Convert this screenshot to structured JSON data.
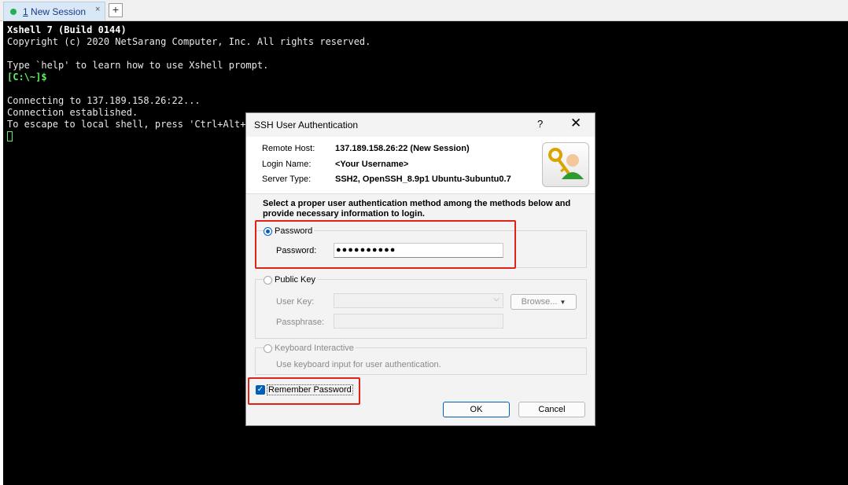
{
  "tabs": {
    "active_num": "1",
    "active_label": "New Session",
    "close": "×",
    "new_tab": "+"
  },
  "terminal": {
    "lines": [
      "Xshell 7 (Build 0144)",
      "Copyright (c) 2020 NetSarang Computer, Inc. All rights reserved.",
      "Type `help' to learn how to use Xshell prompt.",
      "[C:\\~]$",
      "Connecting to 137.189.158.26:22...",
      "Connection established.",
      "To escape to local shell, press 'Ctrl+Alt+]"
    ]
  },
  "dialog": {
    "title": "SSH User Authentication",
    "help": "?",
    "close": "✕",
    "remote_host_label": "Remote Host:",
    "remote_host": "137.189.158.26:22 (New Session)",
    "login_name_label": "Login Name:",
    "login_name": "<Your Username>",
    "server_type_label": "Server Type:",
    "server_type": "SSH2, OpenSSH_8.9p1 Ubuntu-3ubuntu0.7",
    "intro": "Select a proper user authentication method among the methods below and provide necessary information to login.",
    "password_method": "Password",
    "password_label": "Password:",
    "password_value": "●●●●●●●●●●",
    "public_key_method": "Public Key",
    "user_key_label": "User Key:",
    "browse": "Browse...",
    "passphrase_label": "Passphrase:",
    "keyboard_method": "Keyboard Interactive",
    "keyboard_hint": "Use keyboard input for user authentication.",
    "remember": "Remember Password",
    "ok": "OK",
    "cancel": "Cancel"
  },
  "colors": {
    "highlight": "#e0231a",
    "prompt": "#5ef05e",
    "accent": "#005fb8"
  }
}
